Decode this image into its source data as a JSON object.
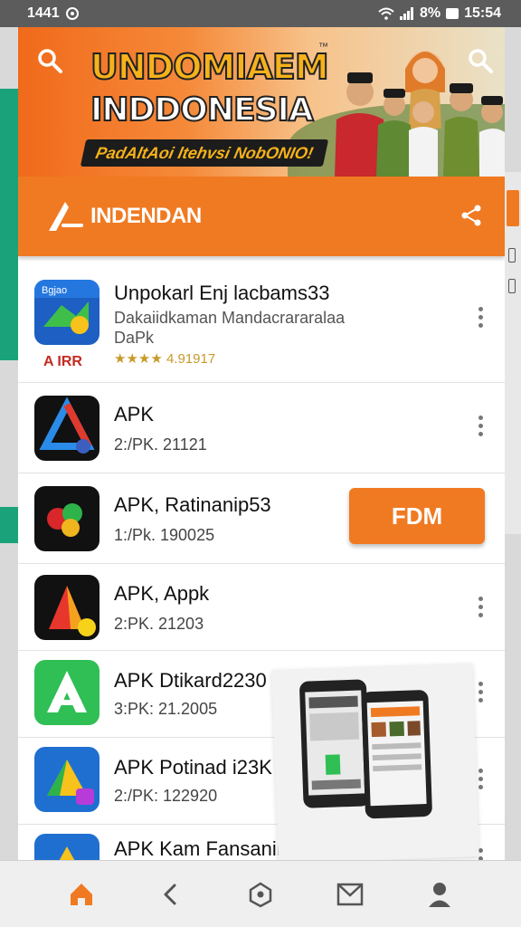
{
  "status_bar": {
    "time_left": "1441",
    "battery": "8%",
    "time_right": "15:54"
  },
  "banner": {
    "title_line1": "UNDOMIAEM",
    "title_tm": "™",
    "title_line2": "INDDONESIA",
    "tagline": "PadAltAoi ltehvsi NobONIO!"
  },
  "header": {
    "brand": "INDENDAN"
  },
  "apps": [
    {
      "title": "Unpokarl Enj lacbams33",
      "desc1": "Dakaiidkaman Mandacrararalaa",
      "desc2": "DaPk",
      "rating": "★★★★ 4.91917",
      "tag": "A IRR"
    },
    {
      "title": "APK",
      "meta": "2:/PK. 21121"
    },
    {
      "title": "APK, Ratinanip53",
      "meta": "1:/Pk. 190025",
      "button": "FDM"
    },
    {
      "title": "APK, Appk",
      "meta": "2:PK. 21203"
    },
    {
      "title": "APK Dtikard2230",
      "meta": "3:PK: 21.2005"
    },
    {
      "title": "APK Potinad i23K",
      "meta": "2:/PK: 122920"
    },
    {
      "title": "APK Kam Fansanild 253",
      "meta": ""
    }
  ],
  "icons": [
    "search-icon",
    "share-icon",
    "more-vert-icon",
    "home-icon",
    "back-icon",
    "recents-icon",
    "mail-icon",
    "profile-icon"
  ],
  "colors": {
    "accent": "#f07a22",
    "status_bar": "#5c5c5c",
    "side_green": "#1aa37a"
  }
}
